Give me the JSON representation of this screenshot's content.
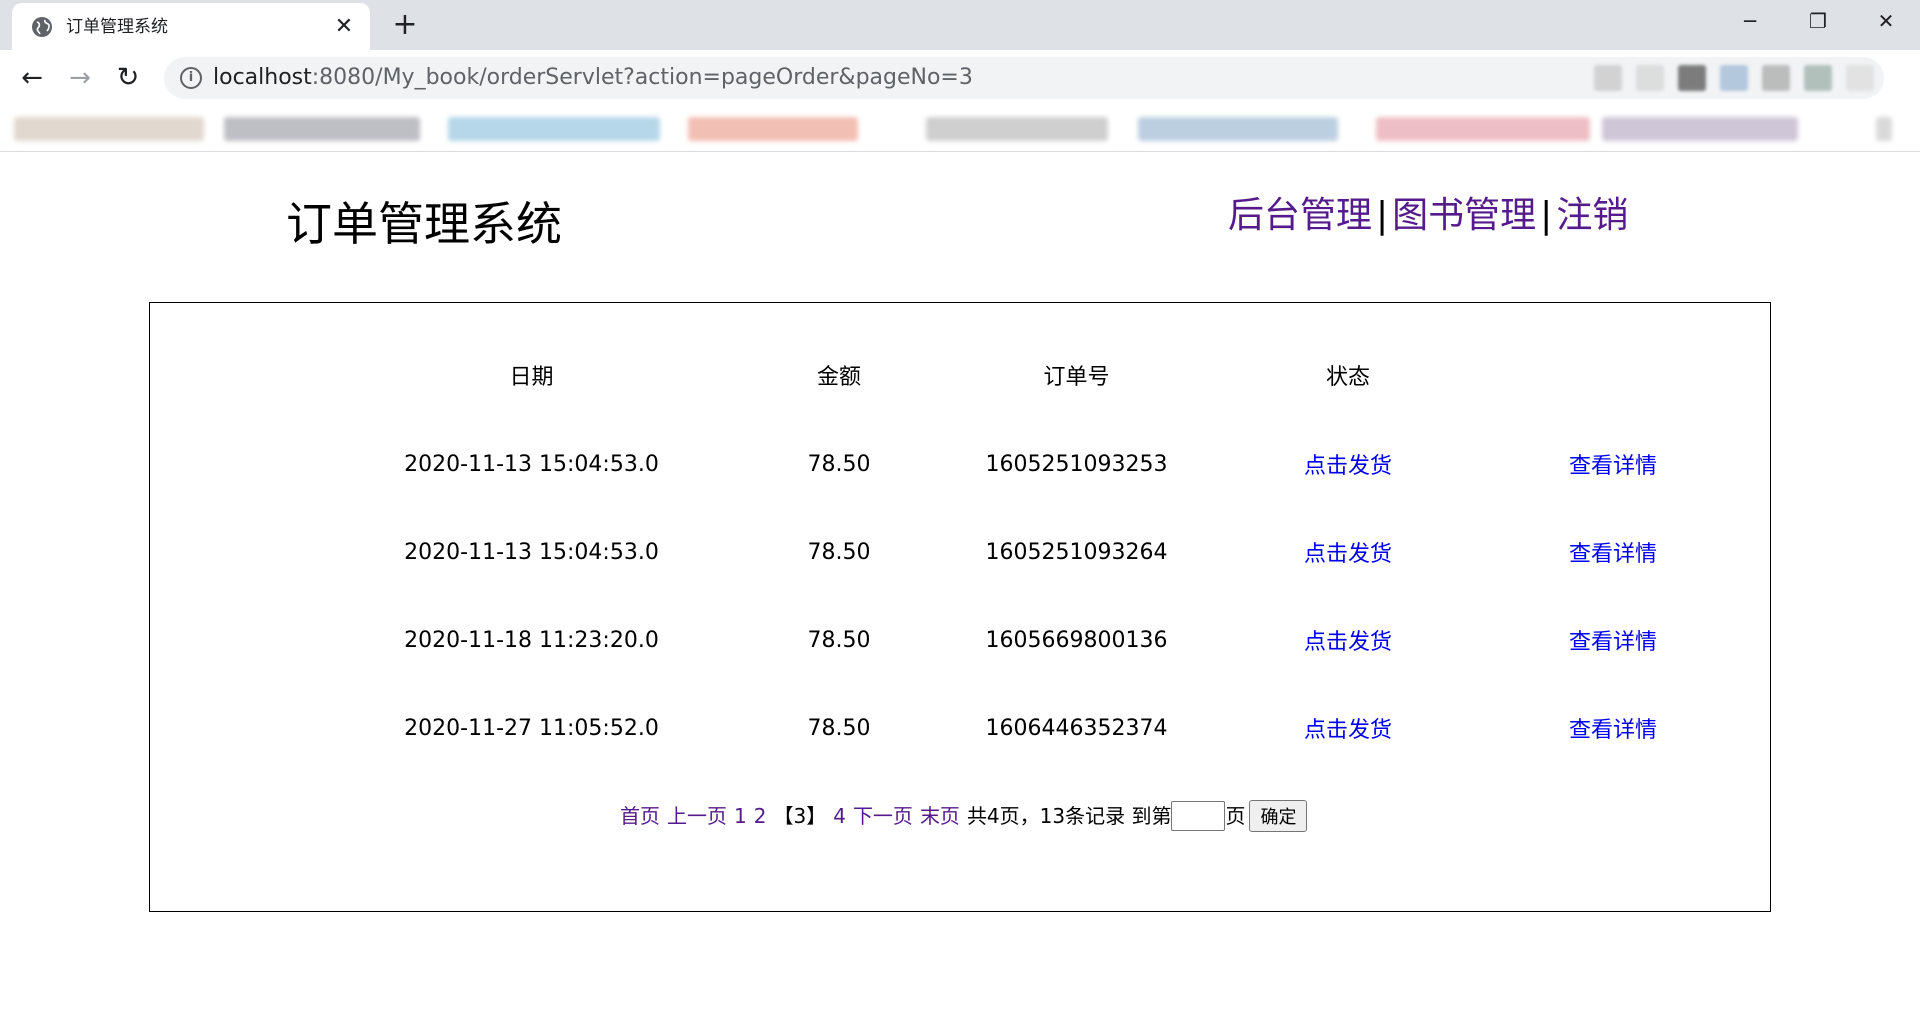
{
  "browser": {
    "tab_title": "订单管理系统",
    "tab_close": "✕",
    "new_tab": "+",
    "window_controls": {
      "minimize": "─",
      "maximize": "❐",
      "close": "✕"
    },
    "nav": {
      "back": "←",
      "forward": "→",
      "reload": "↻"
    },
    "url_host": "localhost",
    "url_rest": ":8080/My_book/orderServlet?action=pageOrder&pageNo=3",
    "info_icon": "i"
  },
  "header": {
    "title": "订单管理系统",
    "links": [
      "后台管理",
      "图书管理",
      "注销"
    ],
    "separator": "|"
  },
  "table": {
    "columns": [
      "日期",
      "金额",
      "订单号",
      "状态",
      ""
    ],
    "rows": [
      {
        "date": "2020-11-13 15:04:53.0",
        "amount": "78.50",
        "order_no": "1605251093253",
        "status": "点击发货",
        "detail": "查看详情"
      },
      {
        "date": "2020-11-13 15:04:53.0",
        "amount": "78.50",
        "order_no": "1605251093264",
        "status": "点击发货",
        "detail": "查看详情"
      },
      {
        "date": "2020-11-18 11:23:20.0",
        "amount": "78.50",
        "order_no": "1605669800136",
        "status": "点击发货",
        "detail": "查看详情"
      },
      {
        "date": "2020-11-27 11:05:52.0",
        "amount": "78.50",
        "order_no": "1606446352374",
        "status": "点击发货",
        "detail": "查看详情"
      }
    ]
  },
  "pager": {
    "first": "首页",
    "prev": "上一页",
    "page1": "1",
    "page2": "2",
    "current": "【3】",
    "page4": "4",
    "next": "下一页",
    "last": "末页",
    "summary": "共4页，13条记录 到第",
    "goto_value": "",
    "page_suffix": "页",
    "confirm": "确定"
  },
  "colors": {
    "visited_link": "#551a8b",
    "link": "#0000ee",
    "tabstrip_bg": "#dee1e6"
  }
}
